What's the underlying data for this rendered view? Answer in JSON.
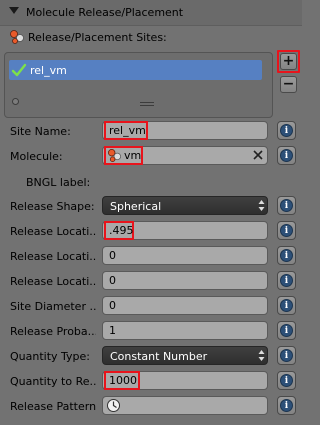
{
  "panel": {
    "title": "Molecule Release/Placement",
    "sites_label": "Release/Placement Sites:"
  },
  "sites_list": {
    "items": [
      {
        "label": "rel_vm",
        "selected": true
      }
    ],
    "add_label": "+",
    "remove_label": "−"
  },
  "fields": {
    "site_name": {
      "label": "Site Name:",
      "value": "rel_vm"
    },
    "molecule": {
      "label": "Molecule:",
      "value": "vm"
    },
    "bngl_label": {
      "label": "BNGL label:"
    },
    "release_shape": {
      "label": "Release Shape:",
      "value": "Spherical"
    },
    "location_x": {
      "label": "Release Locati...",
      "value": ".495"
    },
    "location_y": {
      "label": "Release Locati...",
      "value": "0"
    },
    "location_z": {
      "label": "Release Locati...",
      "value": "0"
    },
    "site_diameter": {
      "label": "Site Diameter ...",
      "value": "0"
    },
    "release_probability": {
      "label": "Release Proba...",
      "value": "1"
    },
    "quantity_type": {
      "label": "Quantity Type:",
      "value": "Constant Number"
    },
    "quantity": {
      "label": "Quantity to Re...",
      "value": "1000"
    },
    "release_pattern": {
      "label": "Release Pattern:",
      "value": ""
    }
  },
  "info_button_label": "i",
  "colors": {
    "highlight": "#e8141c",
    "selection": "#5680c2",
    "panel_bg": "#727272"
  }
}
